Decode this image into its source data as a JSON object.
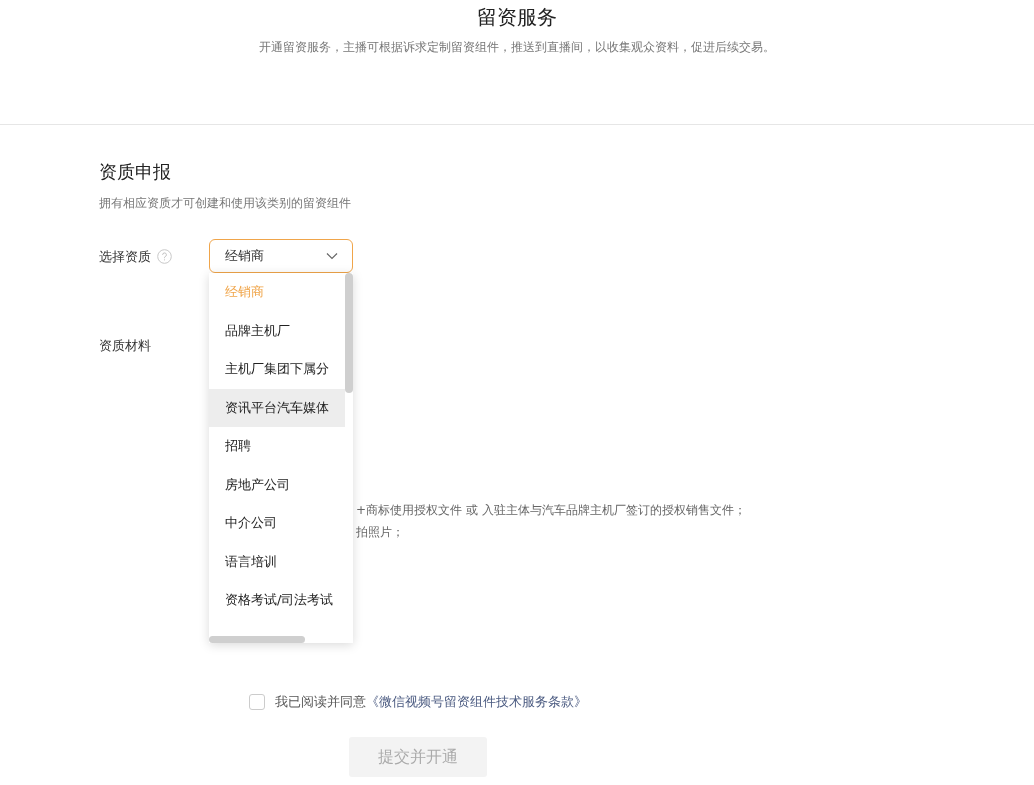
{
  "header": {
    "title": "留资服务",
    "description": "开通留资服务，主播可根据诉求定制留资组件，推送到直播间，以收集观众资料，促进后续交易。"
  },
  "section": {
    "title": "资质申报",
    "description": "拥有相应资质才可创建和使用该类别的留资组件"
  },
  "qualification_select": {
    "label": "选择资质",
    "value": "经销商",
    "expanded": true,
    "options": [
      {
        "label": "经销商",
        "selected": true,
        "hovered": false
      },
      {
        "label": "品牌主机厂",
        "selected": false,
        "hovered": false
      },
      {
        "label": "主机厂集团下属分",
        "selected": false,
        "hovered": false
      },
      {
        "label": "资讯平台汽车媒体",
        "selected": false,
        "hovered": true
      },
      {
        "label": "招聘",
        "selected": false,
        "hovered": false
      },
      {
        "label": "房地产公司",
        "selected": false,
        "hovered": false
      },
      {
        "label": "中介公司",
        "selected": false,
        "hovered": false
      },
      {
        "label": "语言培训",
        "selected": false,
        "hovered": false
      },
      {
        "label": "资格考试/司法考试",
        "selected": false,
        "hovered": false
      }
    ]
  },
  "materials": {
    "label": "资质材料",
    "notes": [
      "+商标使用授权文件 或 入驻主体与汽车品牌主机厂签订的授权销售文件；",
      "拍照片；"
    ]
  },
  "agreement": {
    "checked": false,
    "text": "我已阅读并同意",
    "link": "《微信视频号留资组件技术服务条款》"
  },
  "submit_button": {
    "label": "提交并开通",
    "disabled": true
  }
}
